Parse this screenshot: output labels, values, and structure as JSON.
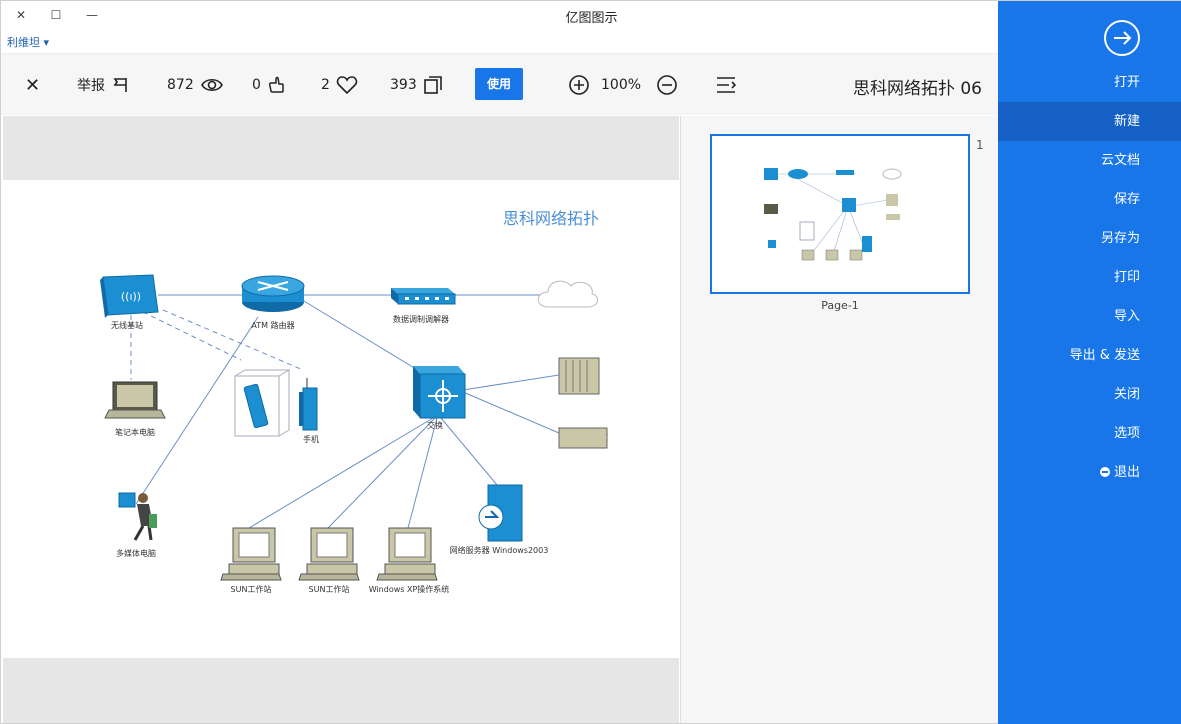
{
  "app": {
    "title": "亿图图示",
    "user_link": "利维坦 ▾"
  },
  "window": {
    "close": "✕",
    "maximize": "☐",
    "minimize": "—"
  },
  "toolbar": {
    "close_icon": "✕",
    "report_label": "举报",
    "views": "872",
    "likes": "0",
    "favorites": "2",
    "copies": "393",
    "use_label": "使用",
    "zoom": "100%",
    "doc_title": "思科网络拓扑 06"
  },
  "diagram": {
    "title": "思科网络拓扑",
    "labels": {
      "wireless": "无线基站",
      "router": "ATM 路由器",
      "modem": "数据调制调解器",
      "cloud": "",
      "laptop": "笔记本电脑",
      "phone": "手机",
      "switch": "交换",
      "user": "多媒体电脑",
      "server": "网络服务器 Windows2003",
      "pc1": "SUN工作站",
      "pc2": "SUN工作站",
      "pc3": "Windows XP操作系统"
    }
  },
  "thumbnails": {
    "index": "1",
    "page_label": "Page-1"
  },
  "sidebar": {
    "items": [
      {
        "label": "打开",
        "active": false
      },
      {
        "label": "新建",
        "active": true
      },
      {
        "label": "云文档",
        "active": false
      },
      {
        "label": "保存",
        "active": false
      },
      {
        "label": "另存为",
        "active": false
      },
      {
        "label": "打印",
        "active": false
      },
      {
        "label": "导入",
        "active": false
      },
      {
        "label": "导出 & 发送",
        "active": false
      },
      {
        "label": "关闭",
        "active": false
      },
      {
        "label": "选项",
        "active": false
      },
      {
        "label": "退出",
        "active": false
      }
    ]
  },
  "colors": {
    "accent": "#1976e8",
    "device_blue": "#1b8fd1",
    "monitor": "#c9c7a8"
  }
}
